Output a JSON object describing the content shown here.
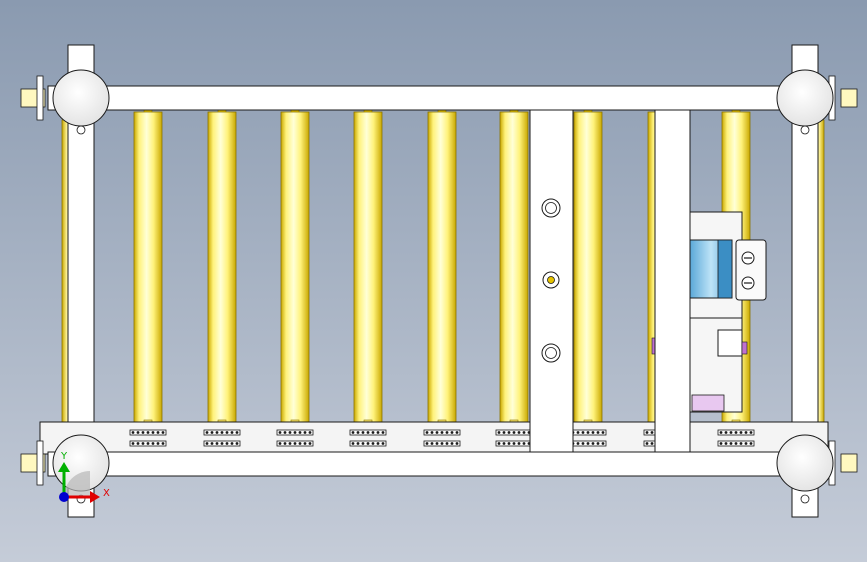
{
  "viewport": {
    "background_top": "#8a9ab0",
    "background_bottom": "#c5ccd8"
  },
  "colors": {
    "frame_fill": "#ffffff",
    "frame_stroke": "#1a1a1a",
    "roller_light": "#ffffd0",
    "roller_mid": "#fff27a",
    "roller_dark": "#c9a800",
    "motor_blue": "#8cc8ee",
    "motor_accent": "#c070d0",
    "triad_x": "#e00000",
    "triad_y": "#00b000",
    "triad_z": "#0000d0"
  },
  "model": {
    "rollers": [
      {
        "name": "roller-1"
      },
      {
        "name": "roller-2"
      },
      {
        "name": "roller-3"
      },
      {
        "name": "roller-4"
      },
      {
        "name": "roller-5"
      },
      {
        "name": "roller-6"
      },
      {
        "name": "roller-7"
      },
      {
        "name": "roller-8"
      },
      {
        "name": "roller-9"
      }
    ],
    "caster_wheels": 4,
    "cross_braces": 2,
    "motor_assembly": true
  },
  "triad": {
    "x_label": "X",
    "y_label": "Y",
    "z_label": ""
  }
}
